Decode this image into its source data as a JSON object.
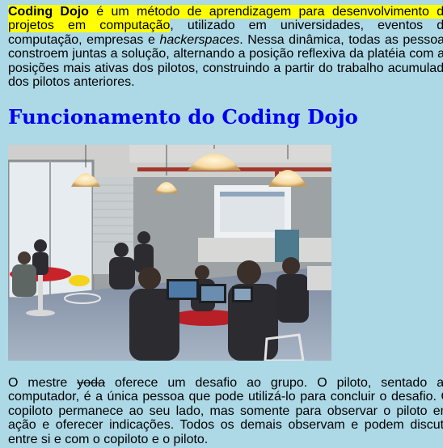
{
  "intro": {
    "term": "Coding Dojo",
    "highlight_rest": " é um método de aprendizagem para desenvolvimento de projetos em computação",
    "text_1": ", utilizado em universidades, eventos de computação, empresas e ",
    "italic_word": "hackerspaces",
    "text_2": ". Nessa dinâmica, todas as pessoas constroem juntas a solução, alternando a posição reflexiva da platéia com as posições mais ativas dos pilotos, construindo a partir do trabalho acumulado dos pilotos anteriores."
  },
  "heading": "Funcionamento do Coding Dojo",
  "photo": {
    "description_icon": "photo-coding-dojo-session"
  },
  "body": {
    "text_1": "O mestre ",
    "struck_word": "yoda",
    "text_2": " oferece um desafio ao grupo. O piloto, sentado ao computador, é a única pessoa que pode utilizá-lo para concluir o desafio. O copiloto permanece ao seu lado, mas somente para observar o piloto em ação e oferecer indicações. Todos os demais observam e podem discutir entre si e com o copiloto e o piloto."
  },
  "colors": {
    "page_background": "#add8e6",
    "heading": "#0000ee",
    "highlight": "#ffff00"
  }
}
